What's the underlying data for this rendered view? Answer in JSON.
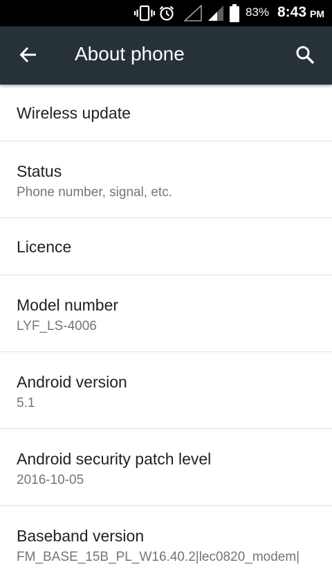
{
  "status_bar": {
    "battery_percent": "83%",
    "time": "8:43",
    "ampm": "PM",
    "icons": [
      "vibrate-icon",
      "alarm-icon",
      "signal-empty-icon",
      "signal-partial-icon",
      "battery-icon"
    ]
  },
  "app_bar": {
    "title": "About phone",
    "back_icon": "arrow-back-icon",
    "search_icon": "search-icon",
    "color": "#263238"
  },
  "items": [
    {
      "title": "Wireless update",
      "summary": ""
    },
    {
      "title": "Status",
      "summary": "Phone number, signal, etc."
    },
    {
      "title": "Licence",
      "summary": ""
    },
    {
      "title": "Model number",
      "summary": "LYF_LS-4006"
    },
    {
      "title": "Android version",
      "summary": "5.1"
    },
    {
      "title": "Android security patch level",
      "summary": "2016-10-05"
    },
    {
      "title": "Baseband version",
      "summary": "FM_BASE_15B_PL_W16.40.2|lec0820_modem|"
    }
  ]
}
